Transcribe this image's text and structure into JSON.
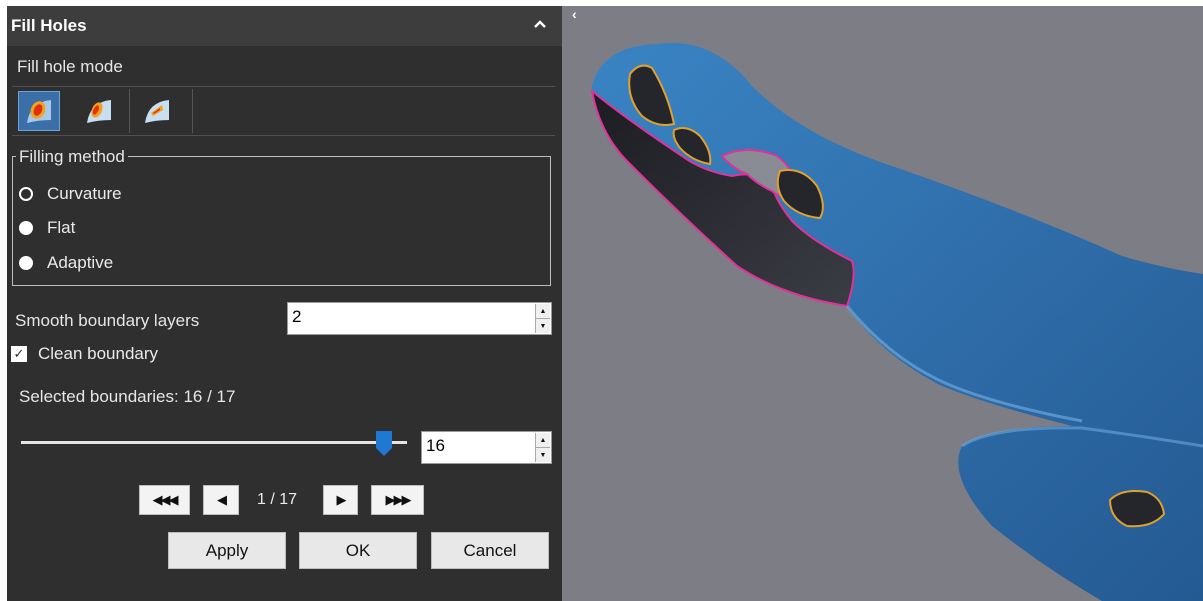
{
  "panel": {
    "title": "Fill Holes",
    "collapse_icon": "chevron-up-icon",
    "fill_hole_mode_label": "Fill hole mode",
    "modes": [
      {
        "icon": "fill-hole-curvature-mode-icon",
        "selected": true
      },
      {
        "icon": "fill-hole-tangent-mode-icon",
        "selected": false
      },
      {
        "icon": "fill-hole-flat-mode-icon",
        "selected": false
      }
    ],
    "filling_method": {
      "legend": "Filling method",
      "options": [
        "Curvature",
        "Flat",
        "Adaptive"
      ],
      "selected": "Curvature"
    },
    "smooth_boundary": {
      "label": "Smooth boundary layers",
      "value": "2"
    },
    "clean_boundary": {
      "label": "Clean boundary",
      "checked": true
    },
    "selected_boundaries": {
      "text": "Selected boundaries: 16 / 17",
      "slider_fraction": 0.94,
      "value": "16"
    },
    "nav": {
      "page_text": "1 / 17"
    },
    "actions": {
      "apply": "Apply",
      "ok": "OK",
      "cancel": "Cancel"
    }
  },
  "viewport": {
    "collapse_icon": "chevron-left-icon",
    "collapse_glyph": "‹"
  },
  "colors": {
    "panel_bg": "#2f2f2f",
    "viewport_bg": "#7d7d85",
    "mesh": "#2f6ea8",
    "selected_boundary": "#e0329a",
    "boundary": "#e0a030",
    "slider_thumb": "#1f78d1"
  }
}
